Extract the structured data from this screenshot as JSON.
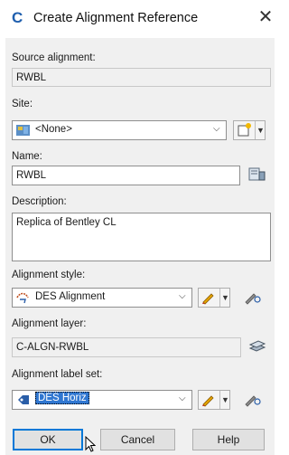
{
  "window": {
    "title": "Create Alignment Reference",
    "app_icon": "C"
  },
  "source": {
    "label": "Source alignment:",
    "value": "RWBL"
  },
  "site": {
    "label": "Site:",
    "value": "<None>"
  },
  "name": {
    "label": "Name:",
    "value": "RWBL"
  },
  "description": {
    "label": "Description:",
    "value": "Replica of Bentley CL"
  },
  "alignment_style": {
    "label": "Alignment style:",
    "value": "DES Alignment"
  },
  "alignment_layer": {
    "label": "Alignment layer:",
    "value": "C-ALGN-RWBL"
  },
  "label_set": {
    "label": "Alignment label set:",
    "value": "DES Horiz"
  },
  "buttons": {
    "ok": "OK",
    "cancel": "Cancel",
    "help": "Help"
  },
  "colors": {
    "accent": "#3077d1",
    "app_icon": "#1f5fae"
  },
  "icons": [
    "app-icon",
    "close-icon",
    "site-icon",
    "create-site-icon",
    "name-picker-icon",
    "style-icon",
    "edit-style-icon",
    "pick-style-icon",
    "layer-icon",
    "label-set-icon",
    "cursor-icon"
  ]
}
